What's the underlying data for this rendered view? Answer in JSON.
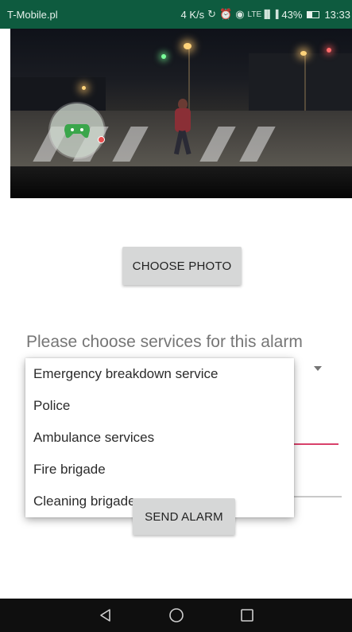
{
  "status_bar": {
    "carrier": "T-Mobile.pl",
    "speed": "4 K/s",
    "network": "LTE",
    "battery": "43%",
    "time": "13:33"
  },
  "photo": {
    "scene": "night street crosswalk with pedestrian"
  },
  "buttons": {
    "choose_photo": "CHOOSE PHOTO",
    "send_alarm": "SEND ALARM"
  },
  "prompt": "Please choose services for this alarm",
  "dropdown": {
    "options": [
      "Emergency breakdown service",
      "Police",
      "Ambulance services",
      "Fire brigade",
      "Cleaning brigade"
    ]
  },
  "icons": {
    "status": [
      "sync-icon",
      "alarm-icon",
      "eye-icon",
      "signal-icon",
      "battery-icon"
    ],
    "nav": [
      "back-icon",
      "home-icon",
      "recents-icon"
    ],
    "overlay": "game-controller-icon"
  },
  "colors": {
    "status_bar": "#0e5b3f",
    "accent_line": "#d8416a",
    "button": "#d6d7d7",
    "nav_bar": "#0f0f0f"
  }
}
